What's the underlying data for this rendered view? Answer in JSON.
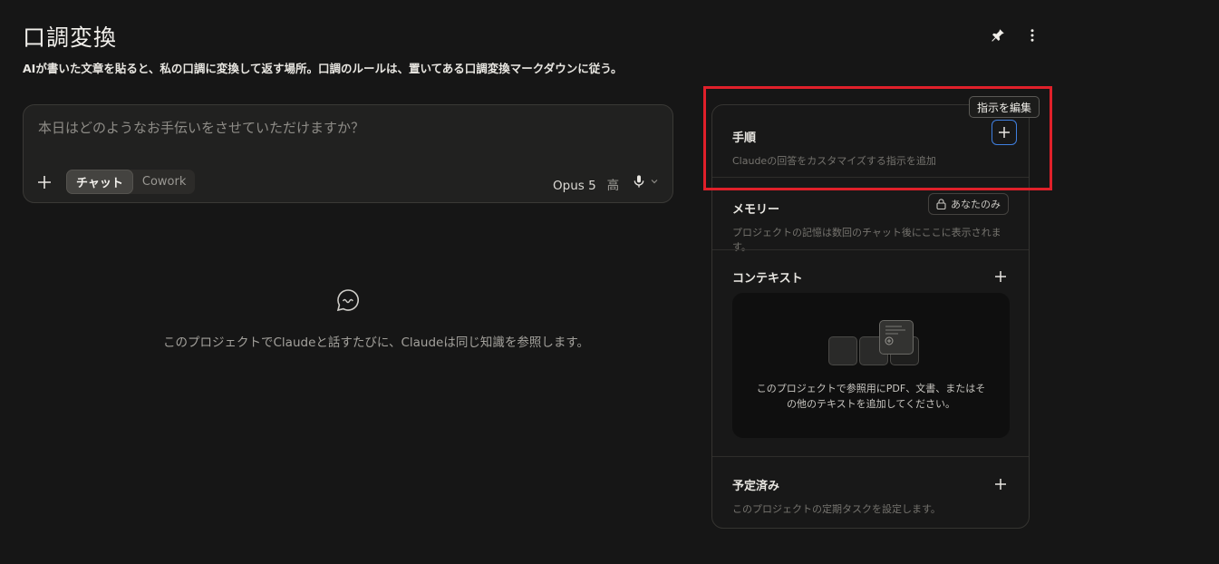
{
  "header": {
    "title": "口調変換",
    "description": "AIが書いた文章を貼ると、私の口調に変換して返す場所。口調のルールは、置いてある口調変換マークダウンに従う。"
  },
  "chat": {
    "placeholder": "本日はどのようなお手伝いをさせていただけますか？",
    "mode_chat": "チャット",
    "mode_cowork": "Cowork",
    "model": "Opus 5",
    "effort": "高"
  },
  "empty_state": {
    "text": "このプロジェクトでClaudeと話すたびに、Claudeは同じ知識を参照します。"
  },
  "panel": {
    "instructions": {
      "title": "手順",
      "subtitle": "Claudeの回答をカスタマイズする指示を追加",
      "tooltip": "指示を編集"
    },
    "memory": {
      "title": "メモリー",
      "badge": "あなたのみ",
      "subtitle": "プロジェクトの記憶は数回のチャット後にここに表示されます。"
    },
    "context": {
      "title": "コンテキスト",
      "drop_line1": "このプロジェクトで参照用にPDF、文書、またはそ",
      "drop_line2": "の他のテキストを追加してください。"
    },
    "scheduled": {
      "title": "予定済み",
      "subtitle": "このプロジェクトの定期タスクを設定します。"
    }
  },
  "colors": {
    "background": "#161616",
    "highlight_box": "#e0202a",
    "focus_ring": "#3f7fe0"
  }
}
